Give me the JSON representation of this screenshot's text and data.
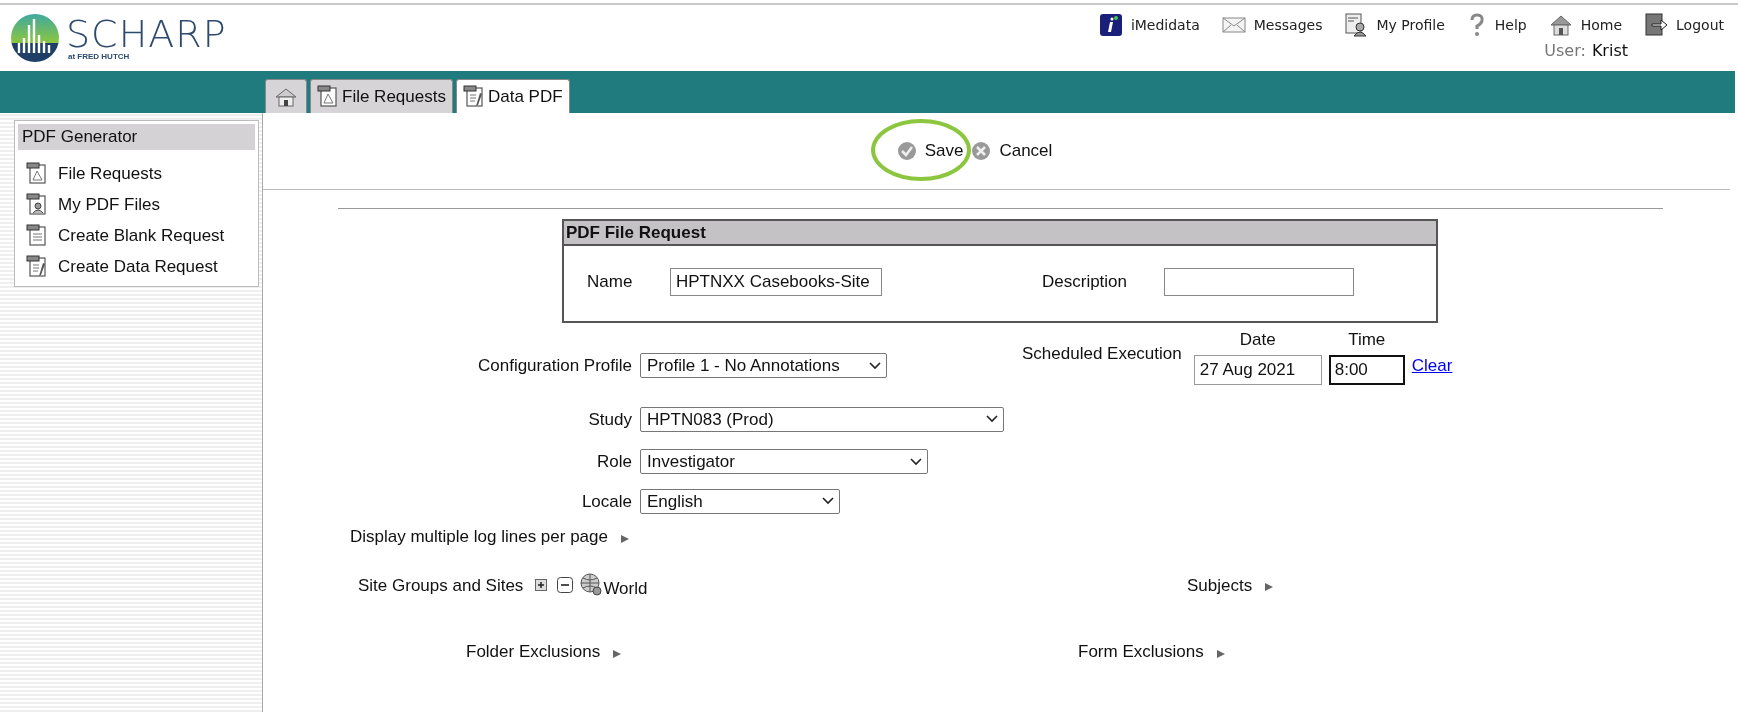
{
  "logo": {
    "name": "SCHARP",
    "subtitle": "at FRED HUTCH"
  },
  "nav": [
    {
      "label": "iMedidata",
      "kind": "info"
    },
    {
      "label": "Messages",
      "kind": "mail"
    },
    {
      "label": "My Profile",
      "kind": "profile"
    },
    {
      "label": "Help",
      "kind": "help"
    },
    {
      "label": "Home",
      "kind": "home"
    },
    {
      "label": "Logout",
      "kind": "logout"
    }
  ],
  "user": {
    "label": "User:",
    "name": "Krist"
  },
  "tabs": [
    {
      "kind": "home",
      "selected": false
    },
    {
      "kind": "requests",
      "label": "File Requests",
      "selected": false
    },
    {
      "kind": "data",
      "label": "Data PDF",
      "selected": true
    }
  ],
  "sidebar": {
    "title": "PDF Generator",
    "items": [
      {
        "label": "File Requests",
        "kind": "requests"
      },
      {
        "label": "My PDF Files",
        "kind": "files"
      },
      {
        "label": "Create Blank Request",
        "kind": "blank"
      },
      {
        "label": "Create Data Request",
        "kind": "data"
      }
    ]
  },
  "toolbar": {
    "save": {
      "label": "Save",
      "highlighted": true
    },
    "cancel": {
      "label": "Cancel"
    }
  },
  "form": {
    "title": "PDF File Request",
    "name": {
      "label": "Name",
      "value": "HPTNXX Casebooks-Site"
    },
    "description": {
      "label": "Description"
    },
    "config_profile": {
      "label": "Configuration Profile",
      "value": "Profile 1 - No Annotations"
    },
    "scheduled_execution": {
      "label": "Scheduled Execution",
      "date_label": "Date",
      "time_label": "Time",
      "date": "27 Aug 2021",
      "time": "8:00",
      "time_focused": true,
      "clear_link": "Clear"
    },
    "study": {
      "label": "Study",
      "value": "HPTN083 (Prod)"
    },
    "role": {
      "label": "Role",
      "value": "Investigator"
    },
    "locale": {
      "label": "Locale",
      "value": "English"
    },
    "log_lines": {
      "label": "Display multiple log lines per page"
    },
    "site_groups": {
      "label": "Site Groups and Sites",
      "root": "World"
    },
    "subjects": {
      "label": "Subjects"
    },
    "folder_exclusions": {
      "label": "Folder Exclusions"
    },
    "form_exclusions": {
      "label": "Form Exclusions"
    }
  }
}
